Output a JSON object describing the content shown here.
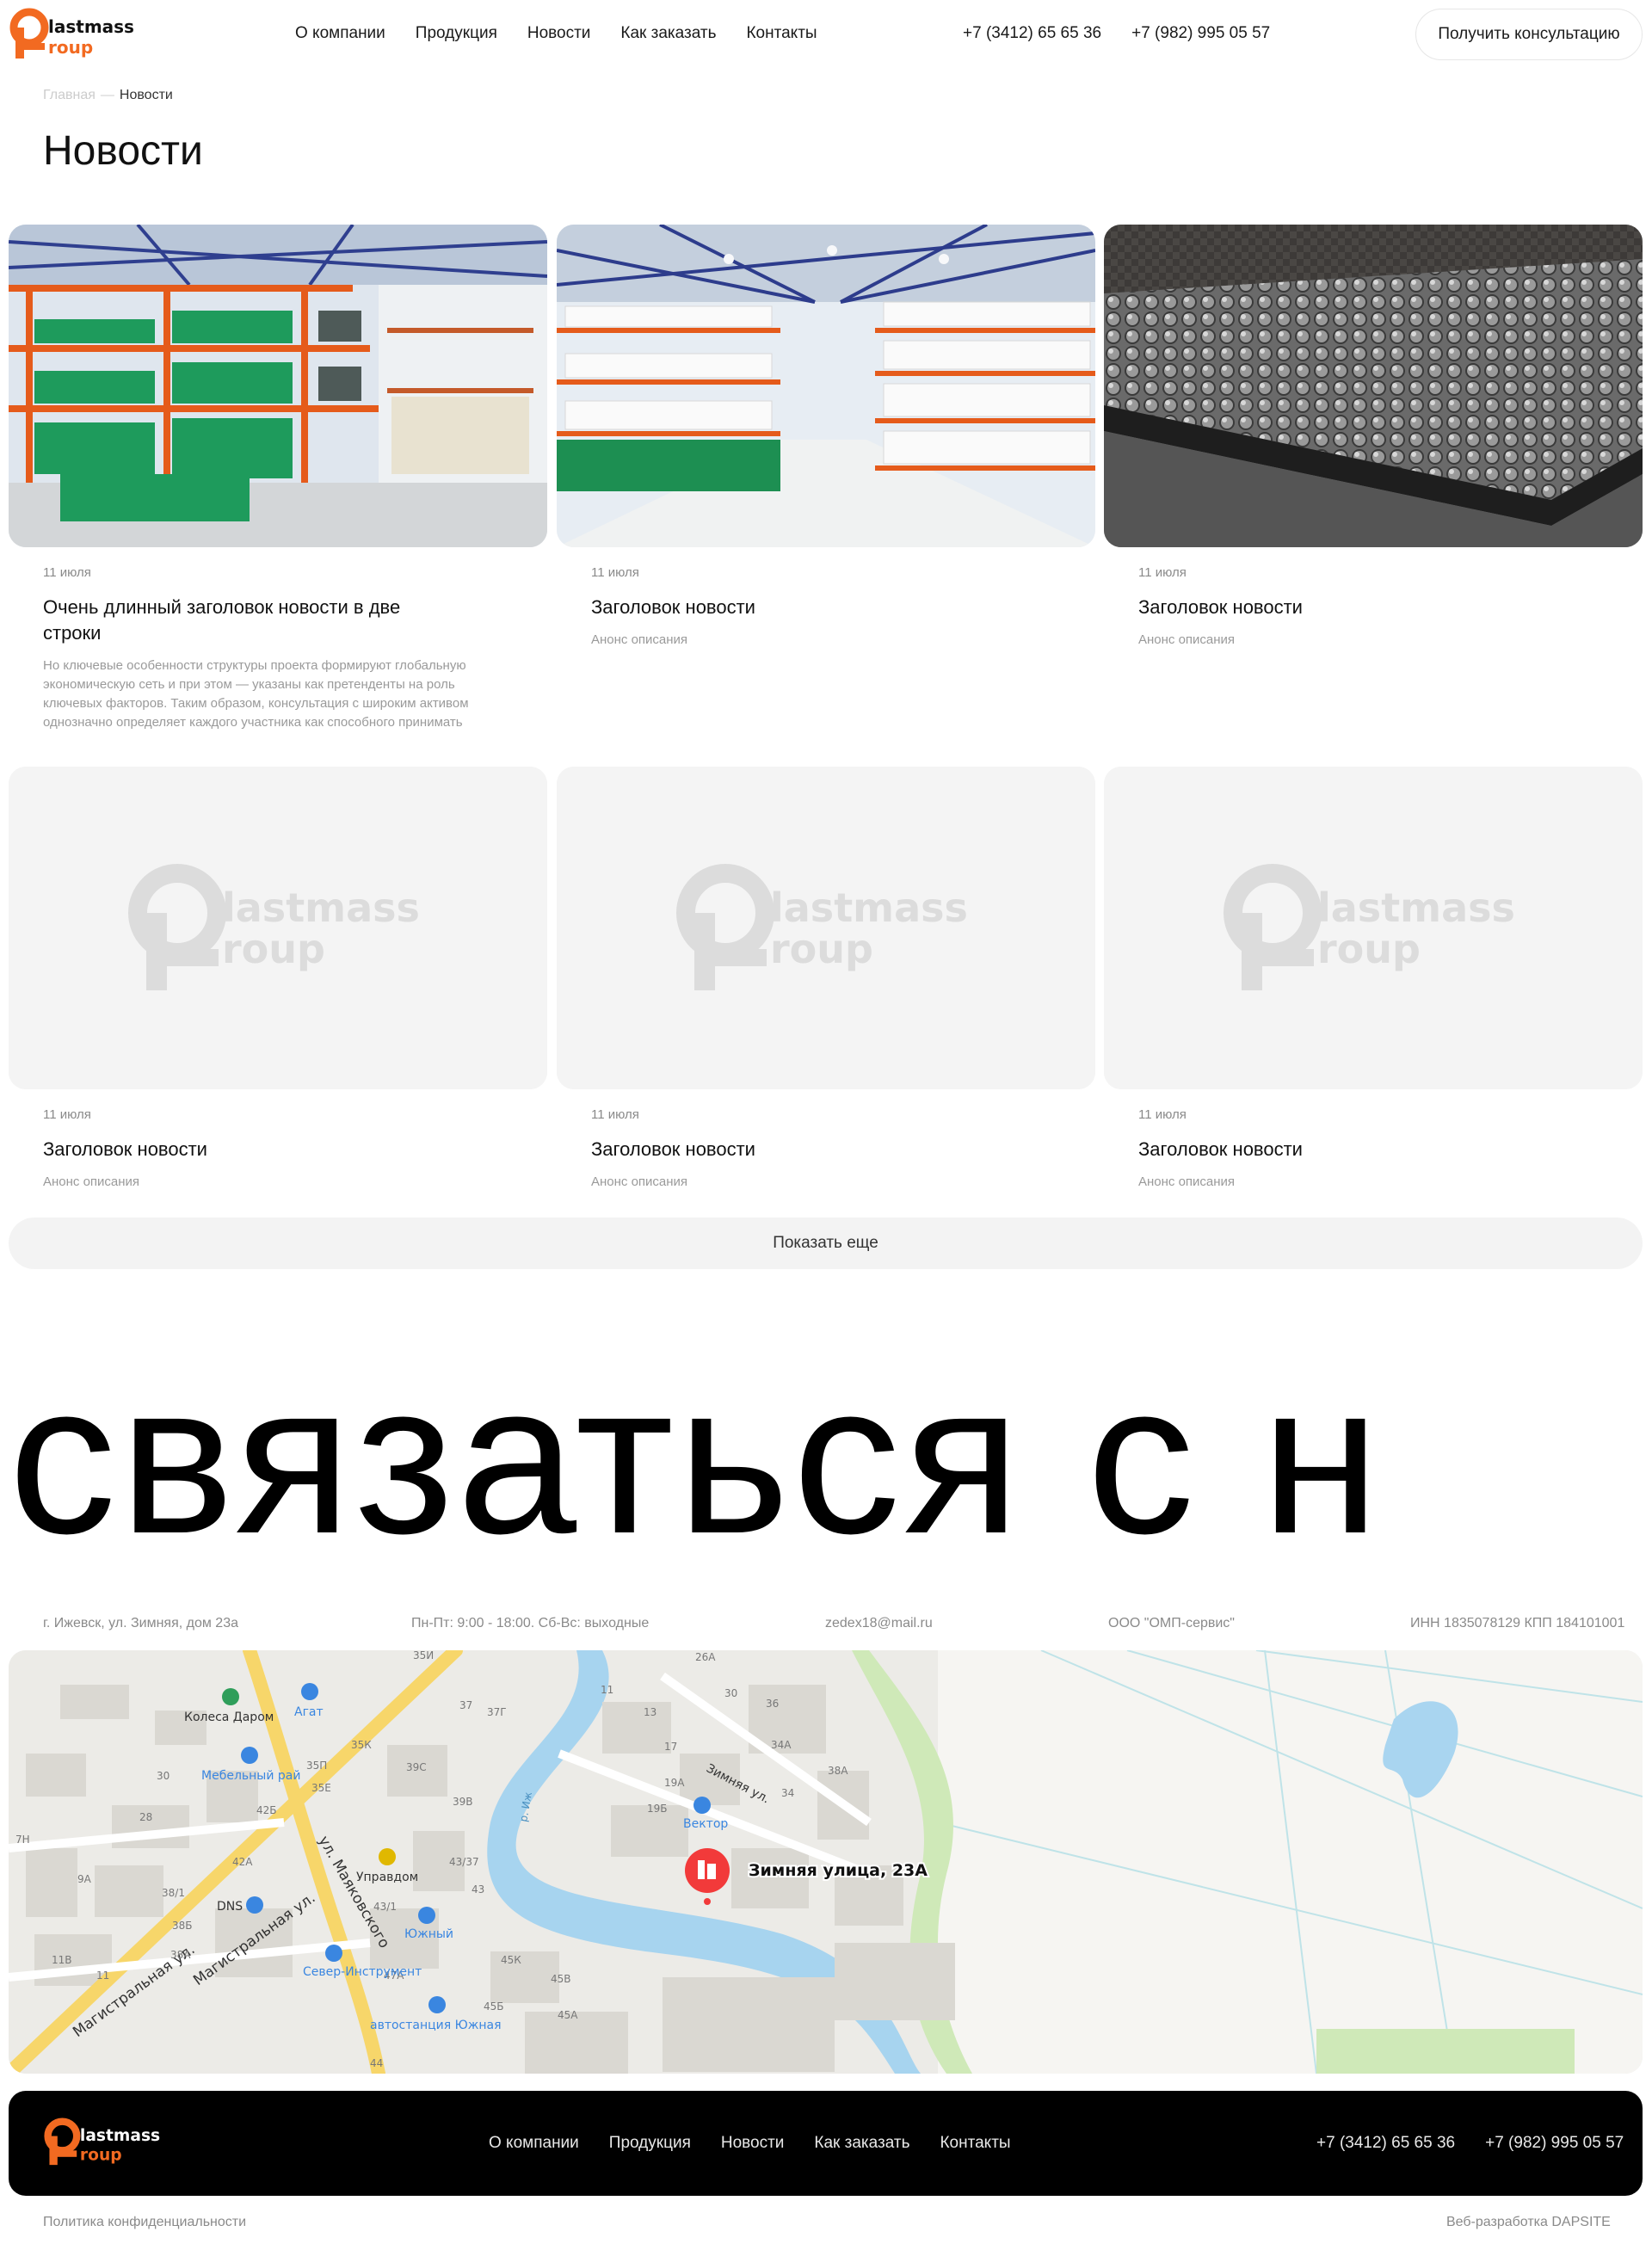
{
  "header": {
    "logo_text_line1": "lastmass",
    "logo_text_line2": "roup",
    "nav": [
      "О компании",
      "Продукция",
      "Новости",
      "Как заказать",
      "Контакты"
    ],
    "phones": [
      "+7 (3412) 65 65 36",
      "+7 (982) 995 05 57"
    ],
    "consult_button": "Получить консультацию"
  },
  "breadcrumb": {
    "home": "Главная",
    "separator": "—",
    "current": "Новости"
  },
  "page_title": "Новости",
  "news": [
    {
      "date": "11 июля",
      "title": "Очень длинный заголовок новости в две строки",
      "desc": "Но ключевые особенности структуры проекта формируют глобальную экономическую сеть и при этом — указаны как претенденты на роль ключевых факторов. Таким образом, консультация с широким активом однозначно определяет каждого участника как способного принимать"
    },
    {
      "date": "11 июля",
      "title": "Заголовок новости",
      "desc": "Анонс описания"
    },
    {
      "date": "11 июля",
      "title": "Заголовок новости",
      "desc": "Анонс описания"
    },
    {
      "date": "11 июля",
      "title": "Заголовок новости",
      "desc": "Анонс описания"
    },
    {
      "date": "11 июля",
      "title": "Заголовок новости",
      "desc": "Анонс описания"
    },
    {
      "date": "11 июля",
      "title": "Заголовок новости",
      "desc": "Анонс описания"
    }
  ],
  "show_more": "Показать еще",
  "contact_heading": "связаться с н",
  "contacts": {
    "address": "г. Ижевск, ул. Зимняя, дом 23а",
    "hours": "Пн-Пт: 9:00 - 18:00. Сб-Вс: выходные",
    "email": "zedex18@mail.ru",
    "company": "ООО \"ОМП-сервис\"",
    "inn": "ИНН 1835078129 КПП 184101001"
  },
  "map": {
    "pin_label": "Зимняя улица, 23А",
    "places": [
      "Колеса Даром",
      "Агат",
      "Мебельный рай",
      "DNS",
      "Управдом",
      "Южный",
      "Север-Инструмент",
      "автостанция Южная",
      "Вектор"
    ],
    "streets": [
      "ул. Маяковского",
      "Магистральная ул.",
      "Магистральная ул.",
      "Зимняя ул.",
      "р. Иж"
    ],
    "house_numbers": [
      "35И",
      "37",
      "37Г",
      "35К",
      "39С",
      "39В",
      "35Е",
      "35П",
      "42Б",
      "42А",
      "43/37",
      "43",
      "43/1",
      "30",
      "28",
      "7Н",
      "9А",
      "38/1",
      "38Б",
      "38А",
      "11В",
      "11",
      "47А",
      "45К",
      "45В",
      "45Б",
      "45А",
      "44",
      "26А",
      "30",
      "36",
      "13",
      "17",
      "34А",
      "38А",
      "19А",
      "19Б",
      "34",
      "11"
    ]
  },
  "footer": {
    "nav": [
      "О компании",
      "Продукция",
      "Новости",
      "Как заказать",
      "Контакты"
    ],
    "phones": [
      "+7 (3412) 65 65 36",
      "+7 (982) 995 05 57"
    ],
    "privacy": "Политика конфиденциальности",
    "developer": "Веб-разработка DAPSITE"
  },
  "colors": {
    "brand_orange": "#f26a21",
    "text": "#111111",
    "muted": "#8a8a8a",
    "pin_red": "#f23a3a"
  }
}
